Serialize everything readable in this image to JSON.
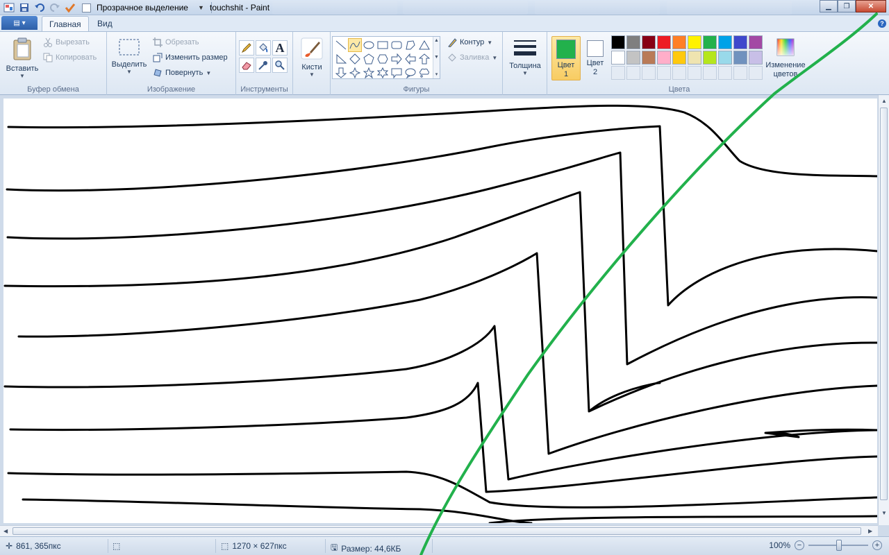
{
  "window": {
    "title": "touchshit - Paint",
    "qat_checkbox_label": "Прозрачное выделение"
  },
  "tabs": [
    {
      "label": "Главная",
      "active": true
    },
    {
      "label": "Вид",
      "active": false
    }
  ],
  "ribbon": {
    "clipboard": {
      "group_label": "Буфер обмена",
      "paste": "Вставить",
      "cut": "Вырезать",
      "copy": "Копировать"
    },
    "image": {
      "group_label": "Изображение",
      "select": "Выделить",
      "crop": "Обрезать",
      "resize": "Изменить размер",
      "rotate": "Повернуть"
    },
    "tools": {
      "group_label": "Инструменты",
      "items": [
        "pencil-icon",
        "fill-icon",
        "text-icon",
        "eraser-icon",
        "color-picker-icon",
        "magnifier-icon"
      ]
    },
    "brushes": {
      "label": "Кисти"
    },
    "shapes": {
      "group_label": "Фигуры",
      "outline": "Контур",
      "fill": "Заливка",
      "selected": "curve"
    },
    "size": {
      "label": "Толщина"
    },
    "colors": {
      "group_label": "Цвета",
      "color1_label": "Цвет",
      "color1_num": "1",
      "color2_label": "Цвет",
      "color2_num": "2",
      "color1_value": "#22b14c",
      "color2_value": "#ffffff",
      "edit_colors_line1": "Изменение",
      "edit_colors_line2": "цветов",
      "palette": [
        "#000000",
        "#7f7f7f",
        "#880015",
        "#ed1c24",
        "#ff7f27",
        "#fff200",
        "#22b14c",
        "#00a2e8",
        "#3f48cc",
        "#a349a4",
        "#ffffff",
        "#c3c3c3",
        "#b97a57",
        "#ffaec9",
        "#ffc90e",
        "#efe4b0",
        "#b5e61d",
        "#99d9ea",
        "#7092be",
        "#c8bfe7",
        "",
        "",
        "",
        "",
        "",
        "",
        "",
        "",
        "",
        ""
      ]
    }
  },
  "status": {
    "cursor_pos": "861, 365пкс",
    "image_size": "1270 × 627пкс",
    "file_size": "Размер: 44,6КБ",
    "zoom": "100%"
  },
  "colors": {
    "stroke": "#000000",
    "accent_stroke": "#22b14c",
    "canvas_bg": "#ffffff"
  }
}
